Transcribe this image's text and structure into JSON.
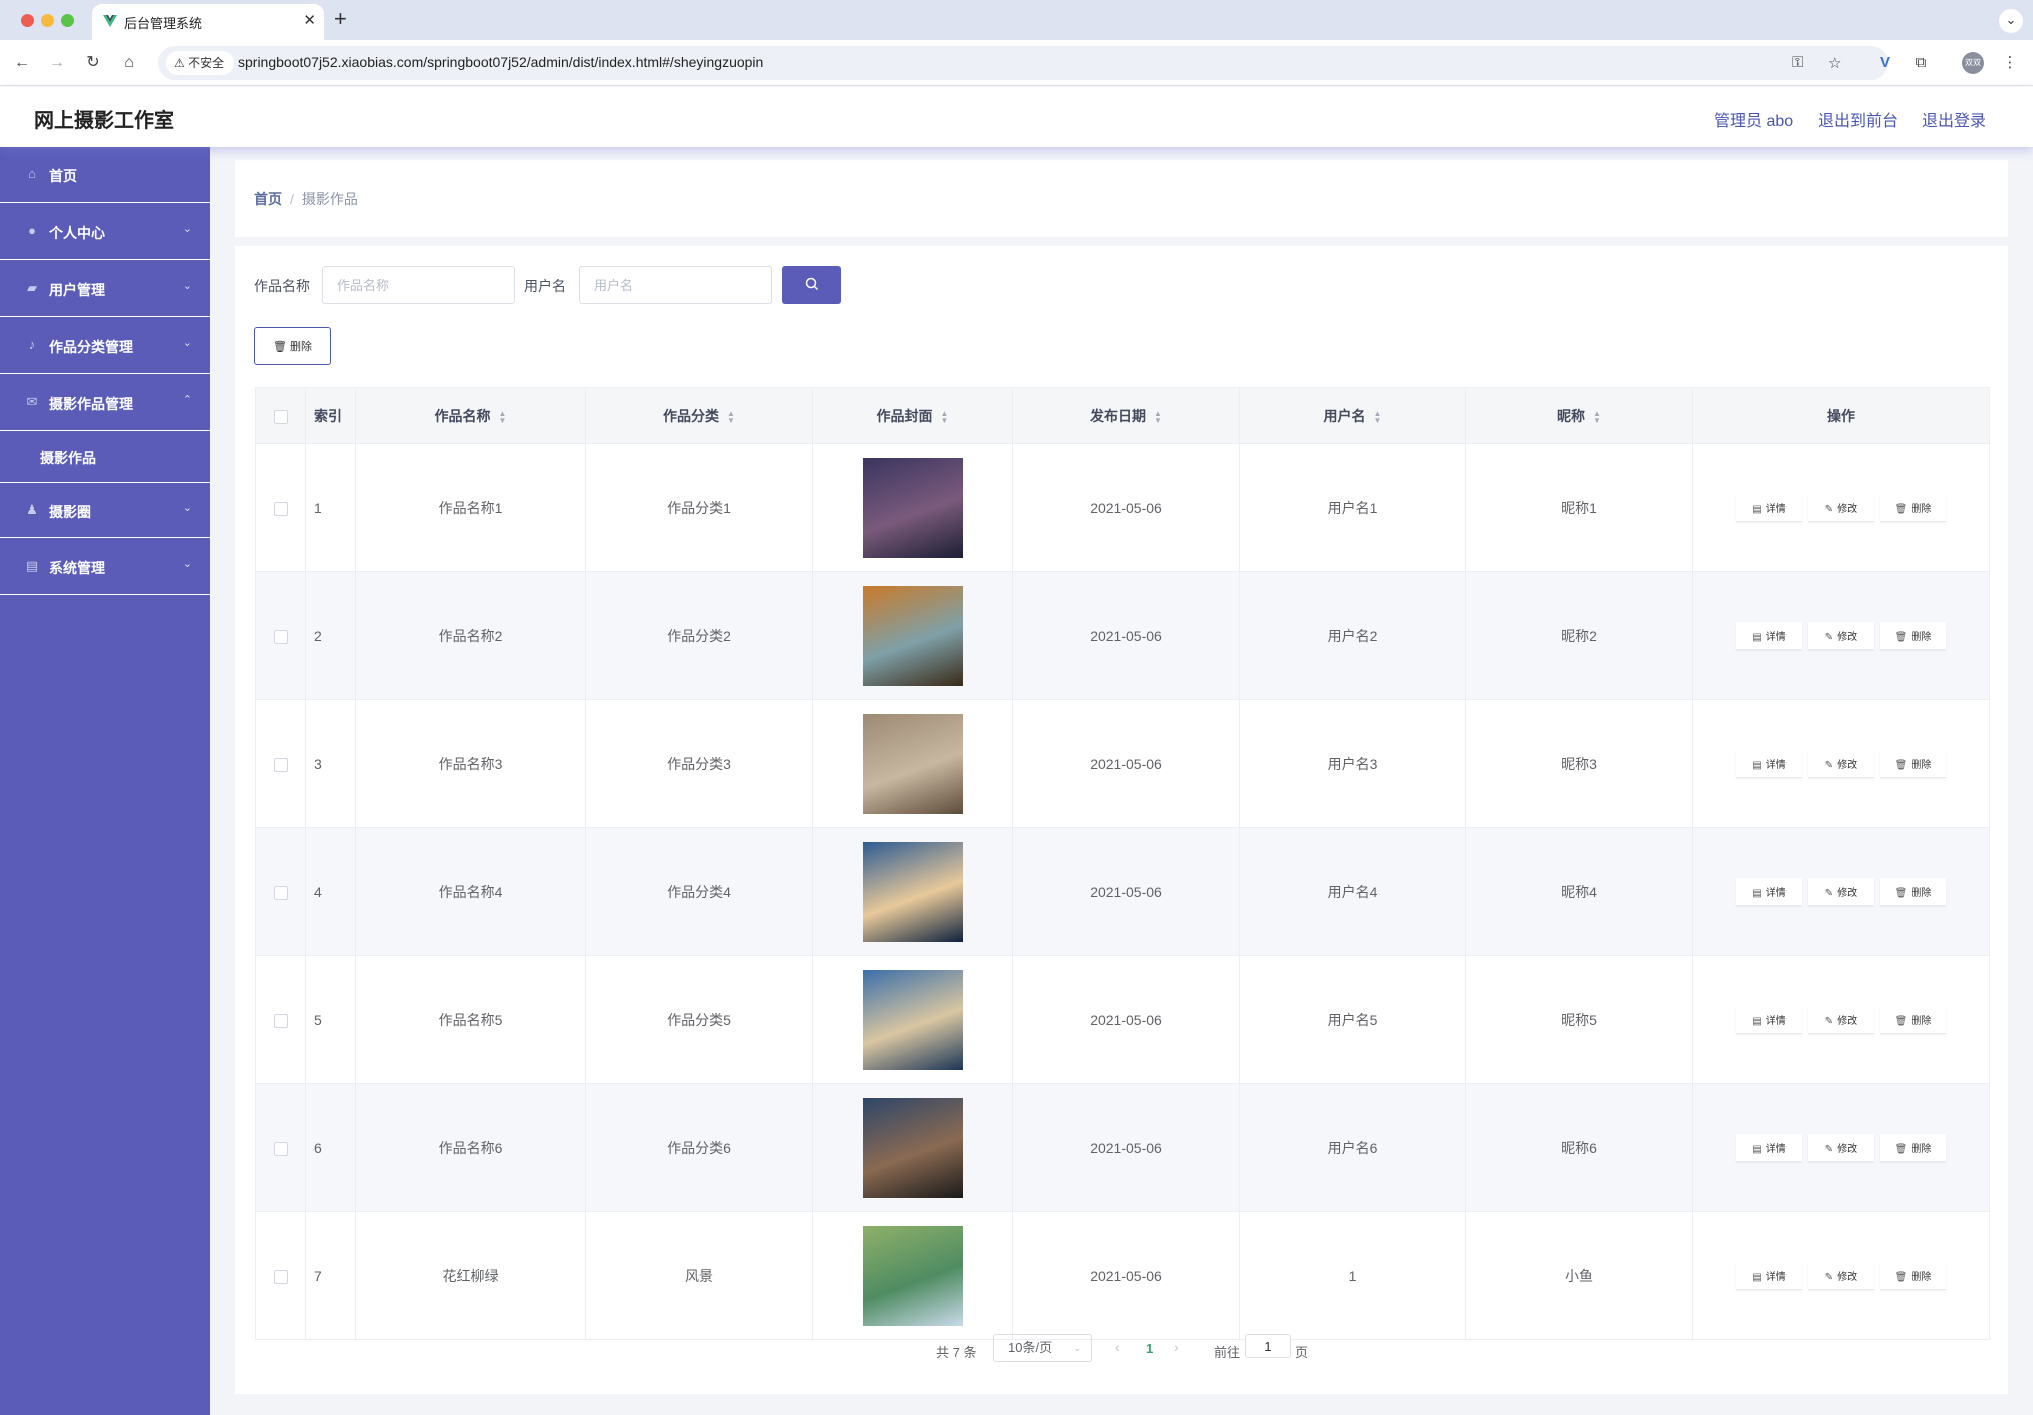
{
  "browser": {
    "tab_title": "后台管理系统",
    "new_tab": "+",
    "security_label": "不安全",
    "url": "springboot07j52.xiaobias.com/springboot07j52/admin/dist/index.html#/sheyingzuopin",
    "profile_initials": "双双"
  },
  "header": {
    "title": "网上摄影工作室",
    "admin_label": "管理员 abo",
    "to_front": "退出到前台",
    "logout": "退出登录"
  },
  "sidebar": {
    "items": [
      {
        "label": "首页",
        "icon": "home-icon"
      },
      {
        "label": "个人中心",
        "icon": "user-icon"
      },
      {
        "label": "用户管理",
        "icon": "users-icon"
      },
      {
        "label": "作品分类管理",
        "icon": "bell-icon"
      },
      {
        "label": "摄影作品管理",
        "icon": "mail-icon"
      },
      {
        "label": "摄影圈",
        "icon": "person-icon"
      },
      {
        "label": "系统管理",
        "icon": "clipboard-icon"
      }
    ],
    "active_sub": "摄影作品"
  },
  "breadcrumb": {
    "home": "首页",
    "sep": "/",
    "current": "摄影作品"
  },
  "search": {
    "name_label": "作品名称",
    "name_placeholder": "作品名称",
    "user_label": "用户名",
    "user_placeholder": "用户名"
  },
  "toolbar": {
    "delete_label": "删除"
  },
  "table": {
    "headers": {
      "index": "索引",
      "name": "作品名称",
      "category": "作品分类",
      "cover": "作品封面",
      "date": "发布日期",
      "user": "用户名",
      "nick": "昵称",
      "ops": "操作"
    },
    "op_labels": {
      "detail": "详情",
      "edit": "修改",
      "delete": "删除"
    },
    "rows": [
      {
        "index": "1",
        "name": "作品名称1",
        "category": "作品分类1",
        "date": "2021-05-06",
        "user": "用户名1",
        "nick": "昵称1",
        "cover_colors": [
          "#3b3560",
          "#7a5a7c",
          "#1c1f33"
        ]
      },
      {
        "index": "2",
        "name": "作品名称2",
        "category": "作品分类2",
        "date": "2021-05-06",
        "user": "用户名2",
        "nick": "昵称2",
        "cover_colors": [
          "#c97a2b",
          "#7fa0a8",
          "#3a2a18"
        ]
      },
      {
        "index": "3",
        "name": "作品名称3",
        "category": "作品分类3",
        "date": "2021-05-06",
        "user": "用户名3",
        "nick": "昵称3",
        "cover_colors": [
          "#9c8a74",
          "#c8b7a0",
          "#5c4c3a"
        ]
      },
      {
        "index": "4",
        "name": "作品名称4",
        "category": "作品分类4",
        "date": "2021-05-06",
        "user": "用户名4",
        "nick": "昵称4",
        "cover_colors": [
          "#2e5b93",
          "#e8c99a",
          "#0f223f"
        ]
      },
      {
        "index": "5",
        "name": "作品名称5",
        "category": "作品分类5",
        "date": "2021-05-06",
        "user": "用户名5",
        "nick": "昵称5",
        "cover_colors": [
          "#3c6fa8",
          "#d9c6a2",
          "#1c3657"
        ]
      },
      {
        "index": "6",
        "name": "作品名称6",
        "category": "作品分类6",
        "date": "2021-05-06",
        "user": "用户名6",
        "nick": "昵称6",
        "cover_colors": [
          "#2f4669",
          "#8a6a52",
          "#1a1a1a"
        ]
      },
      {
        "index": "7",
        "name": "花红柳绿",
        "category": "风景",
        "date": "2021-05-06",
        "user": "1",
        "nick": "小鱼",
        "cover_colors": [
          "#8fb06a",
          "#4f8c62",
          "#c9d9e8"
        ]
      }
    ]
  },
  "pagination": {
    "total": "共 7 条",
    "page_size": "10条/页",
    "current_page": "1",
    "goto_label": "前往",
    "goto_value": "1",
    "page_suffix": "页"
  },
  "colors": {
    "accent": "#5a5cb8",
    "link": "#4b56b1",
    "page_active": "#3ba272"
  }
}
